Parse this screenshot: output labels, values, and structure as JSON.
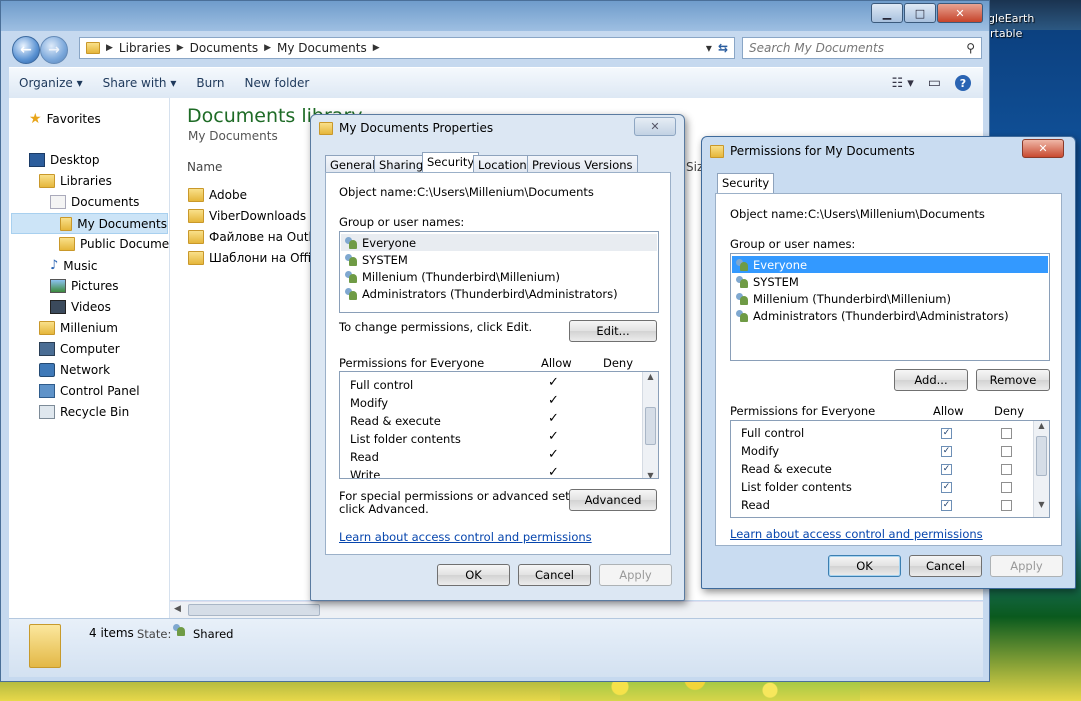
{
  "desktop": {
    "right_icon_label_1": "gleEarth",
    "right_icon_label_2": "rtable"
  },
  "explorer": {
    "breadcrumb": [
      "Libraries",
      "Documents",
      "My Documents"
    ],
    "search_placeholder": "Search My Documents",
    "toolbar": {
      "organize": "Organize",
      "share_with": "Share with",
      "burn": "Burn",
      "new_folder": "New folder"
    },
    "nav": {
      "favorites": "Favorites",
      "desktop": "Desktop",
      "libraries": "Libraries",
      "documents": "Documents",
      "my_documents": "My Documents",
      "public_documents": "Public Documer",
      "music": "Music",
      "pictures": "Pictures",
      "videos": "Videos",
      "millenium": "Millenium",
      "computer": "Computer",
      "network": "Network",
      "control_panel": "Control Panel",
      "recycle_bin": "Recycle Bin"
    },
    "library_title": "Documents library",
    "library_subtitle": "My Documents",
    "column_name": "Name",
    "column_size": "Siz",
    "files": [
      "Adobe",
      "ViberDownloads",
      "Файлове на Outlo",
      "Шаблони на Office"
    ],
    "status": {
      "count": "4 items",
      "state_label": "State:",
      "state_value": "Shared"
    }
  },
  "properties_dialog": {
    "title": "My Documents Properties",
    "tabs": [
      "General",
      "Sharing",
      "Security",
      "Location",
      "Previous Versions"
    ],
    "object_name_label": "Object name:",
    "object_name_value": "C:\\Users\\Millenium\\Documents",
    "group_label": "Group or user names:",
    "users": [
      "Everyone",
      "SYSTEM",
      "Millenium (Thunderbird\\Millenium)",
      "Administrators (Thunderbird\\Administrators)"
    ],
    "change_text": "To change permissions, click Edit.",
    "edit_button": "Edit...",
    "perm_for": "Permissions for Everyone",
    "allow": "Allow",
    "deny": "Deny",
    "permissions": [
      "Full control",
      "Modify",
      "Read & execute",
      "List folder contents",
      "Read",
      "Write"
    ],
    "special_text_1": "For special permissions or advanced settings,",
    "special_text_2": "click Advanced.",
    "advanced_button": "Advanced",
    "learn_link": "Learn about access control and permissions",
    "ok": "OK",
    "cancel": "Cancel",
    "apply": "Apply"
  },
  "permissions_dialog": {
    "title": "Permissions for My Documents",
    "tab": "Security",
    "object_name_label": "Object name:",
    "object_name_value": "C:\\Users\\Millenium\\Documents",
    "group_label": "Group or user names:",
    "users": [
      "Everyone",
      "SYSTEM",
      "Millenium (Thunderbird\\Millenium)",
      "Administrators (Thunderbird\\Administrators)"
    ],
    "add_button": "Add...",
    "remove_button": "Remove",
    "perm_for": "Permissions for Everyone",
    "allow": "Allow",
    "deny": "Deny",
    "permissions": [
      "Full control",
      "Modify",
      "Read & execute",
      "List folder contents",
      "Read"
    ],
    "learn_link": "Learn about access control and permissions",
    "ok": "OK",
    "cancel": "Cancel",
    "apply": "Apply"
  }
}
